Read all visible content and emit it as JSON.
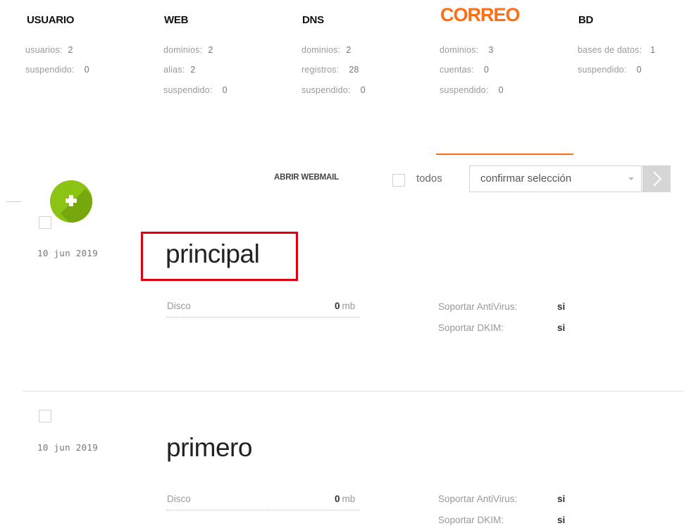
{
  "tabs": [
    {
      "title": "USUARIO",
      "stats": [
        {
          "label": "usuarios:",
          "value": "2"
        },
        {
          "label": "suspendido:",
          "value": "0"
        }
      ]
    },
    {
      "title": "WEB",
      "stats": [
        {
          "label": "dominios:",
          "value": "2"
        },
        {
          "label": "alias:",
          "value": "2"
        },
        {
          "label": "suspendido:",
          "value": "0"
        }
      ]
    },
    {
      "title": "DNS",
      "stats": [
        {
          "label": "dominios:",
          "value": "2"
        },
        {
          "label": "registros:",
          "value": "28"
        },
        {
          "label": "suspendido:",
          "value": "0"
        }
      ]
    },
    {
      "title": "CORREO",
      "active": true,
      "stats": [
        {
          "label": "dominios:",
          "value": "3"
        },
        {
          "label": "cuentas:",
          "value": "0"
        },
        {
          "label": "suspendido:",
          "value": "0"
        }
      ]
    },
    {
      "title": "BD",
      "stats": [
        {
          "label": "bases de datos:",
          "value": "1"
        },
        {
          "label": "suspendido:",
          "value": "0"
        }
      ]
    }
  ],
  "toolbar": {
    "add_icon": "plus-icon",
    "webmail_link": "ABRIR WEBMAIL",
    "select_all_label": "todos",
    "bulk_action": "confirmar selección",
    "go_icon": "chevron-right-icon"
  },
  "items": [
    {
      "date": "10 jun 2019",
      "name": "principal",
      "disk_label": "Disco",
      "disk_value": "0",
      "disk_unit": "mb",
      "antivirus_label": "Soportar AntiVirus:",
      "antivirus_value": "si",
      "dkim_label": "Soportar DKIM:",
      "dkim_value": "si"
    },
    {
      "date": "10 jun 2019",
      "name": "primero",
      "disk_label": "Disco",
      "disk_value": "0",
      "disk_unit": "mb",
      "antivirus_label": "Soportar AntiVirus:",
      "antivirus_value": "si",
      "dkim_label": "Soportar DKIM:",
      "dkim_value": "si"
    }
  ],
  "colors": {
    "accent": "#ff6e14",
    "add_button": "#8bc414",
    "highlight": "#e00010"
  }
}
